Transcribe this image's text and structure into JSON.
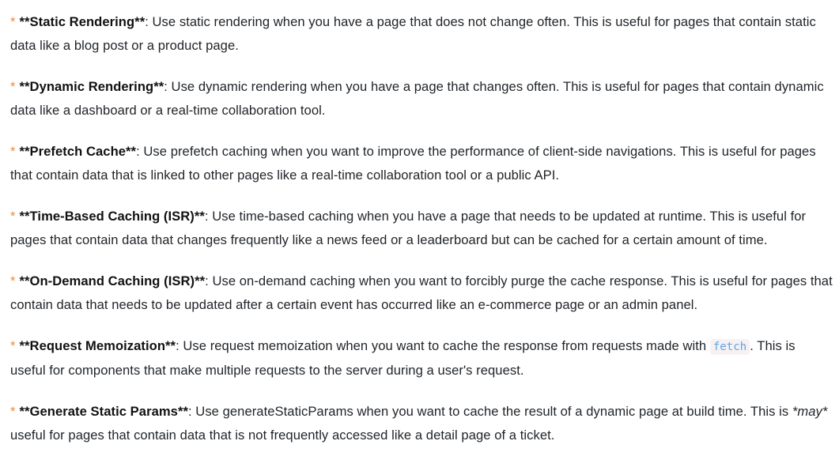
{
  "bullet_glyph": "*",
  "items": [
    {
      "title": "**Static Rendering**",
      "text": ": Use static rendering when you have a page that does not change often. This is useful for pages that contain static data like a blog post or a product page."
    },
    {
      "title": "**Dynamic Rendering**",
      "text": ": Use dynamic rendering when you have a page that changes often. This is useful for pages that contain dynamic data like a dashboard or a real-time collaboration tool."
    },
    {
      "title": "**Prefetch Cache**",
      "text": ": Use prefetch caching when you want to improve the performance of client-side navigations. This is useful for pages that contain data that is linked to other pages like a real-time collaboration tool or a public API."
    },
    {
      "title": "**Time-Based Caching (ISR)**",
      "text": ": Use time-based caching when you have a page that needs to be updated at runtime. This is useful for pages that contain data that changes frequently like a news feed or a leaderboard but can be cached for a certain amount of time."
    },
    {
      "title": "**On-Demand Caching (ISR)**",
      "text": ": Use on-demand caching when you want to forcibly purge the cache response. This is useful for pages that contain data that needs to be updated after a certain event has occurred like an e-commerce page or an admin panel."
    },
    {
      "title": "**Request Memoization**",
      "text_before": ": Use request memoization when you want to cache the response from requests made with ",
      "code": "fetch",
      "text_after": ". This is useful for components that make multiple requests to the server during a user's request."
    },
    {
      "title": "**Generate Static Params**",
      "text_before": ": Use generateStaticParams when you want to cache the result of a dynamic page at build time. This is ",
      "emphasis": "*may*",
      "text_after": " useful for pages that contain data that is not frequently accessed like a detail page of a ticket."
    }
  ]
}
